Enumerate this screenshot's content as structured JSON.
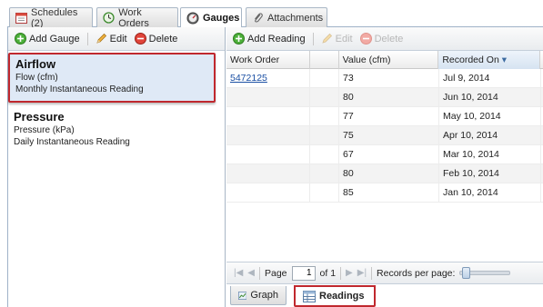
{
  "tabs": [
    {
      "label": "Schedules (2)",
      "icon": "calendar-icon"
    },
    {
      "label": "Work Orders",
      "icon": "clock-icon"
    },
    {
      "label": "Gauges",
      "icon": "gauge-icon"
    },
    {
      "label": "Attachments",
      "icon": "paperclip-icon"
    }
  ],
  "left_toolbar": {
    "add": "Add Gauge",
    "edit": "Edit",
    "delete": "Delete"
  },
  "gauges": [
    {
      "name": "Airflow",
      "unit": "Flow (cfm)",
      "reading": "Monthly Instantaneous Reading"
    },
    {
      "name": "Pressure",
      "unit": "Pressure (kPa)",
      "reading": "Daily Instantaneous Reading"
    }
  ],
  "right_toolbar": {
    "add": "Add Reading",
    "edit": "Edit",
    "delete": "Delete"
  },
  "grid": {
    "columns": [
      "Work Order",
      "",
      "Value (cfm)",
      "Recorded On"
    ],
    "sort_indicator": "▾",
    "rows": [
      {
        "work_order": "5472125",
        "value": "73",
        "date": "Jul 9, 2014"
      },
      {
        "work_order": "",
        "value": "80",
        "date": "Jun 10, 2014"
      },
      {
        "work_order": "",
        "value": "77",
        "date": "May 10, 2014"
      },
      {
        "work_order": "",
        "value": "75",
        "date": "Apr 10, 2014"
      },
      {
        "work_order": "",
        "value": "67",
        "date": "Mar 10, 2014"
      },
      {
        "work_order": "",
        "value": "80",
        "date": "Feb 10, 2014"
      },
      {
        "work_order": "",
        "value": "85",
        "date": "Jan 10, 2014"
      }
    ]
  },
  "pager": {
    "page_label": "Page",
    "page_value": "1",
    "of_label": "of 1",
    "records_label": "Records per page:"
  },
  "bottom_tabs": {
    "graph": "Graph",
    "readings": "Readings"
  },
  "colors": {
    "selection_border": "#c0282e",
    "link": "#1a4fa3",
    "selected_bg": "#dfe9f6"
  }
}
